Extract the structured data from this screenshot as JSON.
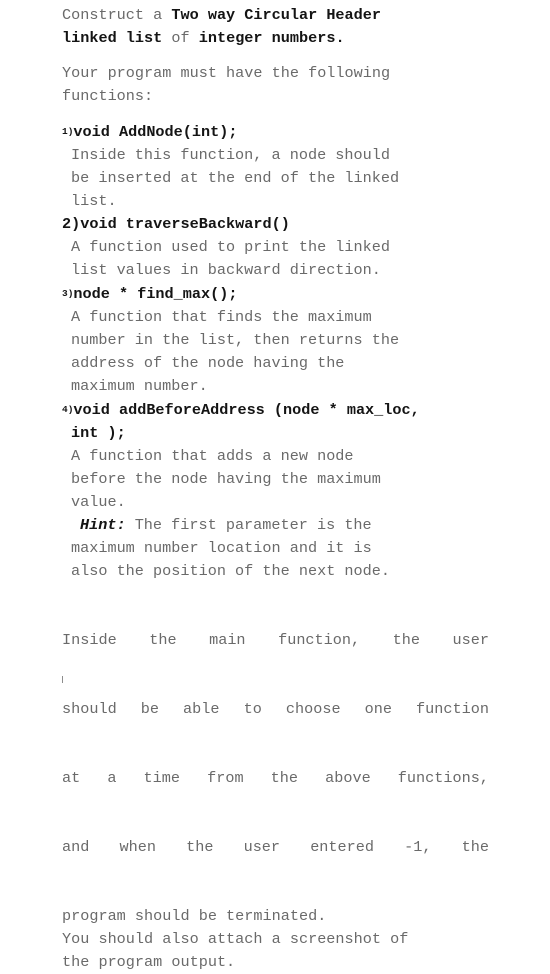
{
  "document": {
    "intro": {
      "line1_pre": "Construct a ",
      "line1_bold": "Two way Circular Header",
      "line2_bold_a": "linked list",
      "line2_mid": " of ",
      "line2_bold_b": "integer numbers",
      "line2_end": ".",
      "para2_line1": "Your program must have the following",
      "para2_line2": "functions:"
    },
    "functions": [
      {
        "marker": "1)",
        "marker_small": true,
        "signature": "void AddNode(int);",
        "description_lines": [
          "Inside this function, a node should",
          "be inserted at the end of the linked",
          "list."
        ]
      },
      {
        "marker": "2)",
        "marker_small": false,
        "signature": "void traverseBackward()",
        "description_lines": [
          "A function used to print the linked",
          "list values in backward direction."
        ]
      },
      {
        "marker": "3)",
        "marker_small": true,
        "signature": "node * find_max();",
        "description_lines": [
          "A function that finds the maximum",
          "number in the list, then returns the",
          "address of the node having the",
          "maximum number."
        ]
      },
      {
        "marker": "4)",
        "marker_small": true,
        "signature": "void addBeforeAddress (node * max_loc,",
        "signature_line2": "int );",
        "description_lines": [
          "A function that adds a new node",
          "before the node having the maximum",
          "value."
        ],
        "hint_label": "Hint:",
        "hint_lines": [
          " The first parameter is the",
          "maximum number location and it is",
          "also the position of the next node."
        ]
      }
    ],
    "closing": {
      "justified_lines": [
        [
          "Inside",
          "the",
          "main",
          "function,",
          "the",
          "user"
        ],
        [
          "should",
          "be",
          "able",
          "to",
          "choose",
          "one",
          "function"
        ],
        [
          "at",
          "a",
          "time",
          "from",
          "the",
          "above",
          "functions,"
        ],
        [
          "and",
          "when",
          "the",
          "user",
          "entered",
          "-1,",
          "the"
        ]
      ],
      "tail_lines": [
        "program should be terminated.",
        "You should also attach a screenshot of",
        "the program output."
      ]
    }
  }
}
